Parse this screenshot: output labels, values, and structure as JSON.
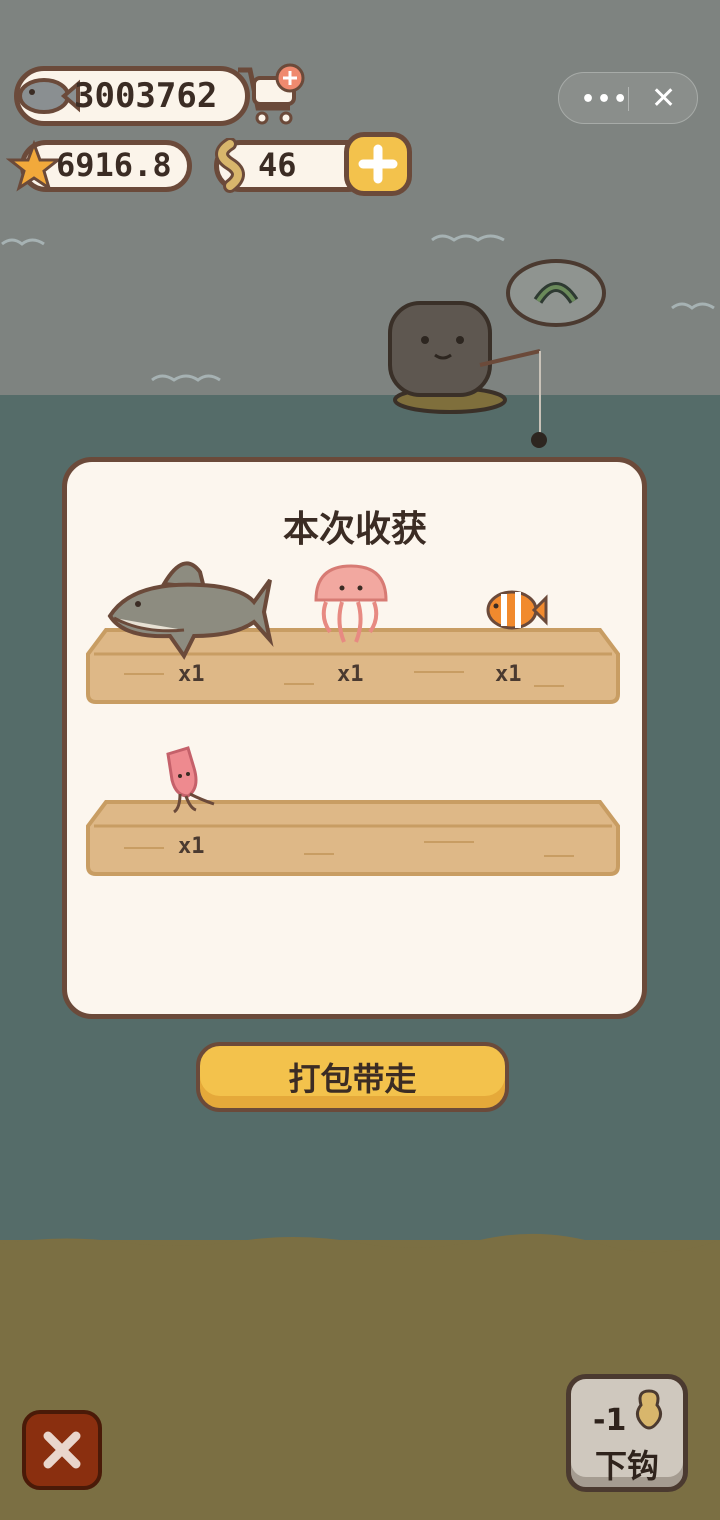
{
  "hud": {
    "fish_coins": "3003762",
    "stars": "6916.8",
    "worms": "46",
    "icons": [
      "fish-icon",
      "cart-add-icon",
      "starfish-icon",
      "worm-icon",
      "plus-icon"
    ]
  },
  "mini_program": {
    "more": "•••",
    "close": "✕"
  },
  "popup": {
    "title": "本次收获",
    "rows": [
      [
        {
          "name": "shark",
          "qty": "x1"
        },
        {
          "name": "jellyfish",
          "qty": "x1"
        },
        {
          "name": "clownfish",
          "qty": "x1"
        }
      ],
      [
        {
          "name": "squid",
          "qty": "x1"
        }
      ]
    ],
    "pack_button": "打包带走"
  },
  "controls": {
    "close_icon": "close-icon",
    "hook_cost": "-1",
    "hook_label": "下钩"
  },
  "colors": {
    "sky": "#7e8380",
    "sea": "#556c69",
    "sand": "#7b6f43",
    "panel": "#fcf6ee",
    "border": "#6b4a3a",
    "button_yellow": "#f3c24c"
  }
}
